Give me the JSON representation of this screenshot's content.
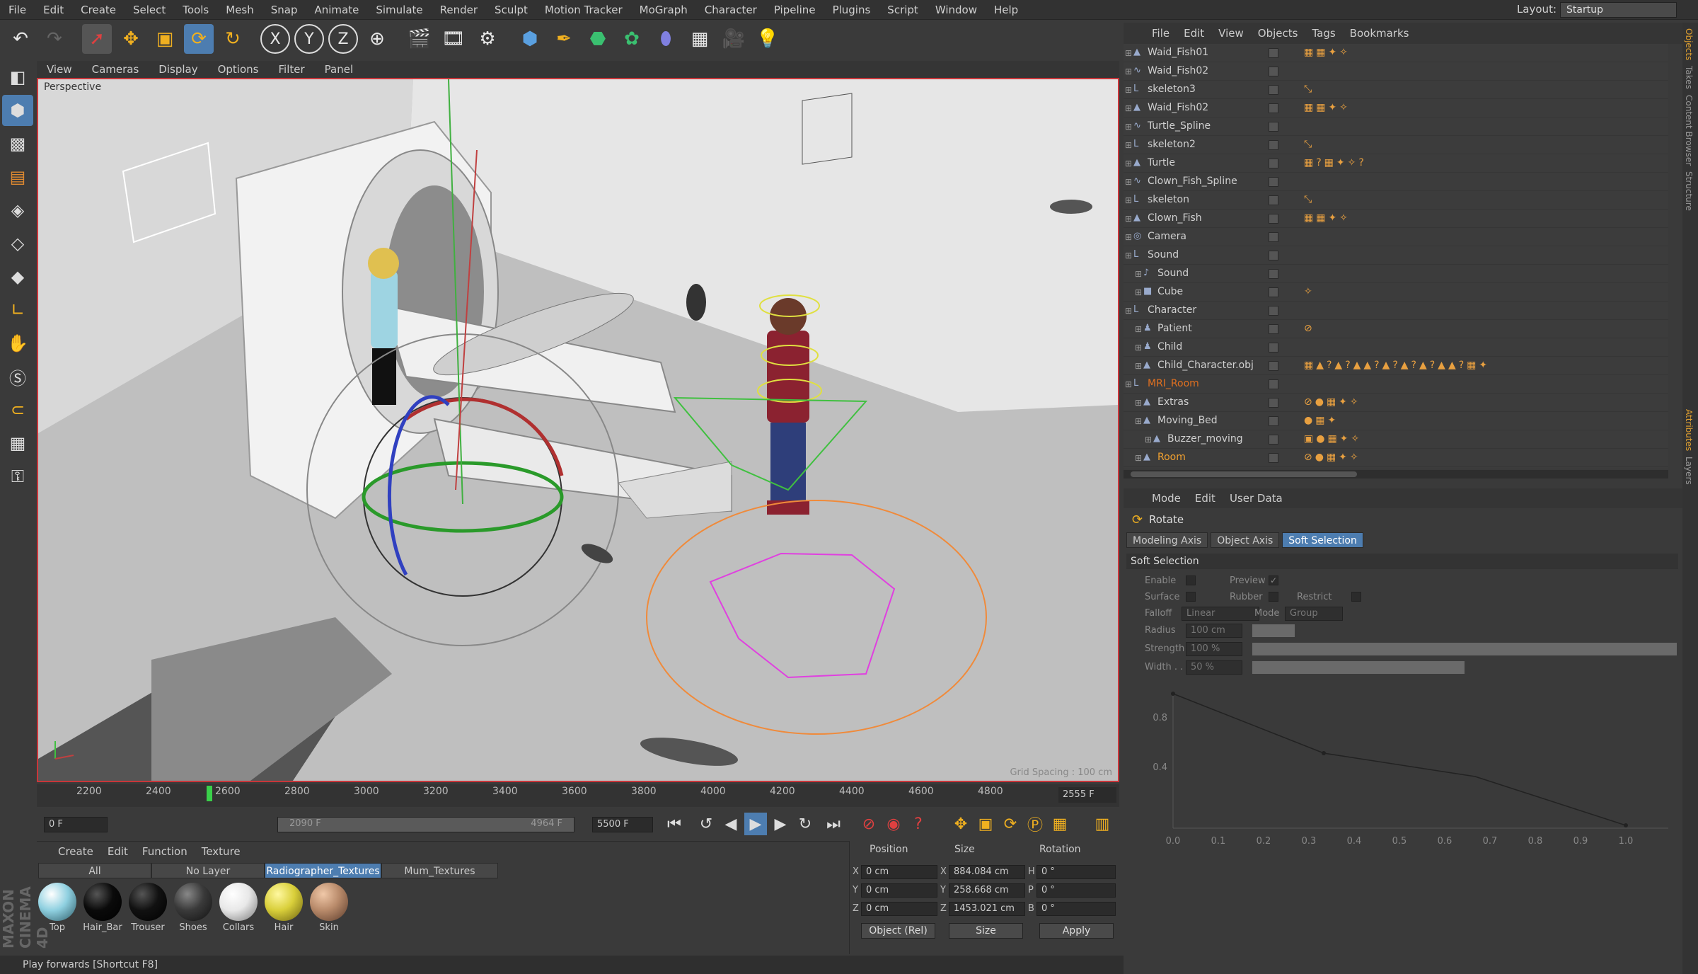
{
  "menubar": {
    "items": [
      "File",
      "Edit",
      "Create",
      "Select",
      "Tools",
      "Mesh",
      "Snap",
      "Animate",
      "Simulate",
      "Render",
      "Sculpt",
      "Motion Tracker",
      "MoGraph",
      "Character",
      "Pipeline",
      "Plugins",
      "Script",
      "Window",
      "Help"
    ],
    "layout_label": "Layout:",
    "layout_value": "Startup"
  },
  "viewport": {
    "menu": [
      "View",
      "Cameras",
      "Display",
      "Options",
      "Filter",
      "Panel"
    ],
    "label": "Perspective",
    "grid_spacing": "Grid Spacing : 100 cm"
  },
  "timeline": {
    "ticks": [
      "2200",
      "2400",
      "2600",
      "2800",
      "3000",
      "3200",
      "3400",
      "3600",
      "3800",
      "4000",
      "4200",
      "4400",
      "4600",
      "4800"
    ],
    "end_frame": "2555 F"
  },
  "playbar": {
    "current": "0 F",
    "range_start": "2090 F",
    "range_end": "4964 F",
    "max": "5500 F"
  },
  "materials": {
    "menu": [
      "Create",
      "Edit",
      "Function",
      "Texture"
    ],
    "tabs": [
      "All",
      "No Layer",
      "Radiographer_Textures",
      "Mum_Textures"
    ],
    "active_tab": "Radiographer_Textures",
    "items": [
      {
        "label": "Top",
        "color": "#8fd0e0"
      },
      {
        "label": "Hair_Bar",
        "color": "#0a0a0a"
      },
      {
        "label": "Trouser",
        "color": "#111111"
      },
      {
        "label": "Shoes",
        "color": "#3a3a3a"
      },
      {
        "label": "Collars",
        "color": "#e8e8e8"
      },
      {
        "label": "Hair",
        "color": "#d9cf3a"
      },
      {
        "label": "Skin",
        "color": "#b88a6a"
      }
    ]
  },
  "coords": {
    "headers": [
      "Position",
      "Size",
      "Rotation"
    ],
    "rows": [
      {
        "axis": "X",
        "pos": "0 cm",
        "size_axis": "X",
        "size": "884.084 cm",
        "rot_axis": "H",
        "rot": "0 °"
      },
      {
        "axis": "Y",
        "pos": "0 cm",
        "size_axis": "Y",
        "size": "258.668 cm",
        "rot_axis": "P",
        "rot": "0 °"
      },
      {
        "axis": "Z",
        "pos": "0 cm",
        "size_axis": "Z",
        "size": "1453.021 cm",
        "rot_axis": "B",
        "rot": "0 °"
      }
    ],
    "mode": "Object (Rel)",
    "size_mode": "Size",
    "apply": "Apply"
  },
  "status": "Play forwards [Shortcut F8]",
  "brand": "MAXON CINEMA 4D",
  "objects": {
    "menu": [
      "File",
      "Edit",
      "View",
      "Objects",
      "Tags",
      "Bookmarks"
    ],
    "rows": [
      {
        "name": "Waid_Fish01",
        "indent": 0,
        "icon": "mesh",
        "tags": "▦▦✦✧"
      },
      {
        "name": "Waid_Fish02",
        "indent": 0,
        "icon": "spline",
        "tags": ""
      },
      {
        "name": "skeleton3",
        "indent": 0,
        "icon": "null",
        "tags": "⤡"
      },
      {
        "name": "Waid_Fish02",
        "indent": 0,
        "icon": "mesh",
        "tags": "▦▦✦✧"
      },
      {
        "name": "Turtle_Spline",
        "indent": 0,
        "icon": "spline",
        "tags": ""
      },
      {
        "name": "skeleton2",
        "indent": 0,
        "icon": "null",
        "tags": "⤡"
      },
      {
        "name": "Turtle",
        "indent": 0,
        "icon": "mesh",
        "tags": "▦?▦✦✧?"
      },
      {
        "name": "Clown_Fish_Spline",
        "indent": 0,
        "icon": "spline",
        "tags": ""
      },
      {
        "name": "skeleton",
        "indent": 0,
        "icon": "null",
        "tags": "⤡"
      },
      {
        "name": "Clown_Fish",
        "indent": 0,
        "icon": "mesh",
        "tags": "▦▦✦✧"
      },
      {
        "name": "Camera",
        "indent": 0,
        "icon": "camera",
        "tags": ""
      },
      {
        "name": "Sound",
        "indent": 0,
        "icon": "null",
        "tags": ""
      },
      {
        "name": "Sound",
        "indent": 1,
        "icon": "sound",
        "tags": ""
      },
      {
        "name": "Cube",
        "indent": 1,
        "icon": "cube",
        "tags": "✧"
      },
      {
        "name": "Character",
        "indent": 0,
        "icon": "null",
        "tags": ""
      },
      {
        "name": "Patient",
        "indent": 1,
        "icon": "char",
        "tags": "⊘"
      },
      {
        "name": "Child",
        "indent": 1,
        "icon": "char",
        "tags": ""
      },
      {
        "name": "Child_Character.obj",
        "indent": 1,
        "icon": "mesh",
        "tags": "▦▲?▲?▲▲?▲?▲?▲?▲▲?▦✦"
      },
      {
        "name": "MRI_Room",
        "indent": 0,
        "icon": "null",
        "tags": ""
      },
      {
        "name": "Extras",
        "indent": 1,
        "icon": "mesh",
        "tags": "⊘●▦✦✧"
      },
      {
        "name": "Moving_Bed",
        "indent": 1,
        "icon": "mesh",
        "tags": "●▦✦"
      },
      {
        "name": "Buzzer_moving",
        "indent": 2,
        "icon": "mesh",
        "tags": "▣●▦✦✧"
      },
      {
        "name": "Room",
        "indent": 1,
        "icon": "mesh",
        "tags": "⊘●▦✦✧"
      }
    ]
  },
  "attributes": {
    "menu": [
      "Mode",
      "Edit",
      "User Data"
    ],
    "title": "Rotate",
    "tabs": [
      "Modeling Axis",
      "Object Axis",
      "Soft Selection"
    ],
    "active_tab": "Soft Selection",
    "section": "Soft Selection",
    "labels": {
      "enable": "Enable",
      "preview": "Preview",
      "surface": "Surface",
      "rubber": "Rubber",
      "restrict": "Restrict",
      "falloff": "Falloff",
      "falloff_value": "Linear",
      "mode": "Mode",
      "mode_value": "Group",
      "radius": "Radius",
      "radius_value": "100 cm",
      "strength": "Strength",
      "strength_value": "100 %",
      "width": "Width . .",
      "width_value": "50 %"
    },
    "strength_fraction": 1.0,
    "width_fraction": 0.5,
    "graph_x_ticks": [
      "0.0",
      "0.1",
      "0.2",
      "0.3",
      "0.4",
      "0.5",
      "0.6",
      "0.7",
      "0.8",
      "0.9",
      "1.0"
    ],
    "graph_y_ticks": [
      "0.8",
      "0.4"
    ]
  },
  "right_strip": [
    "Objects",
    "Takes",
    "Content Browser",
    "Structure",
    "Attributes",
    "Layers"
  ]
}
